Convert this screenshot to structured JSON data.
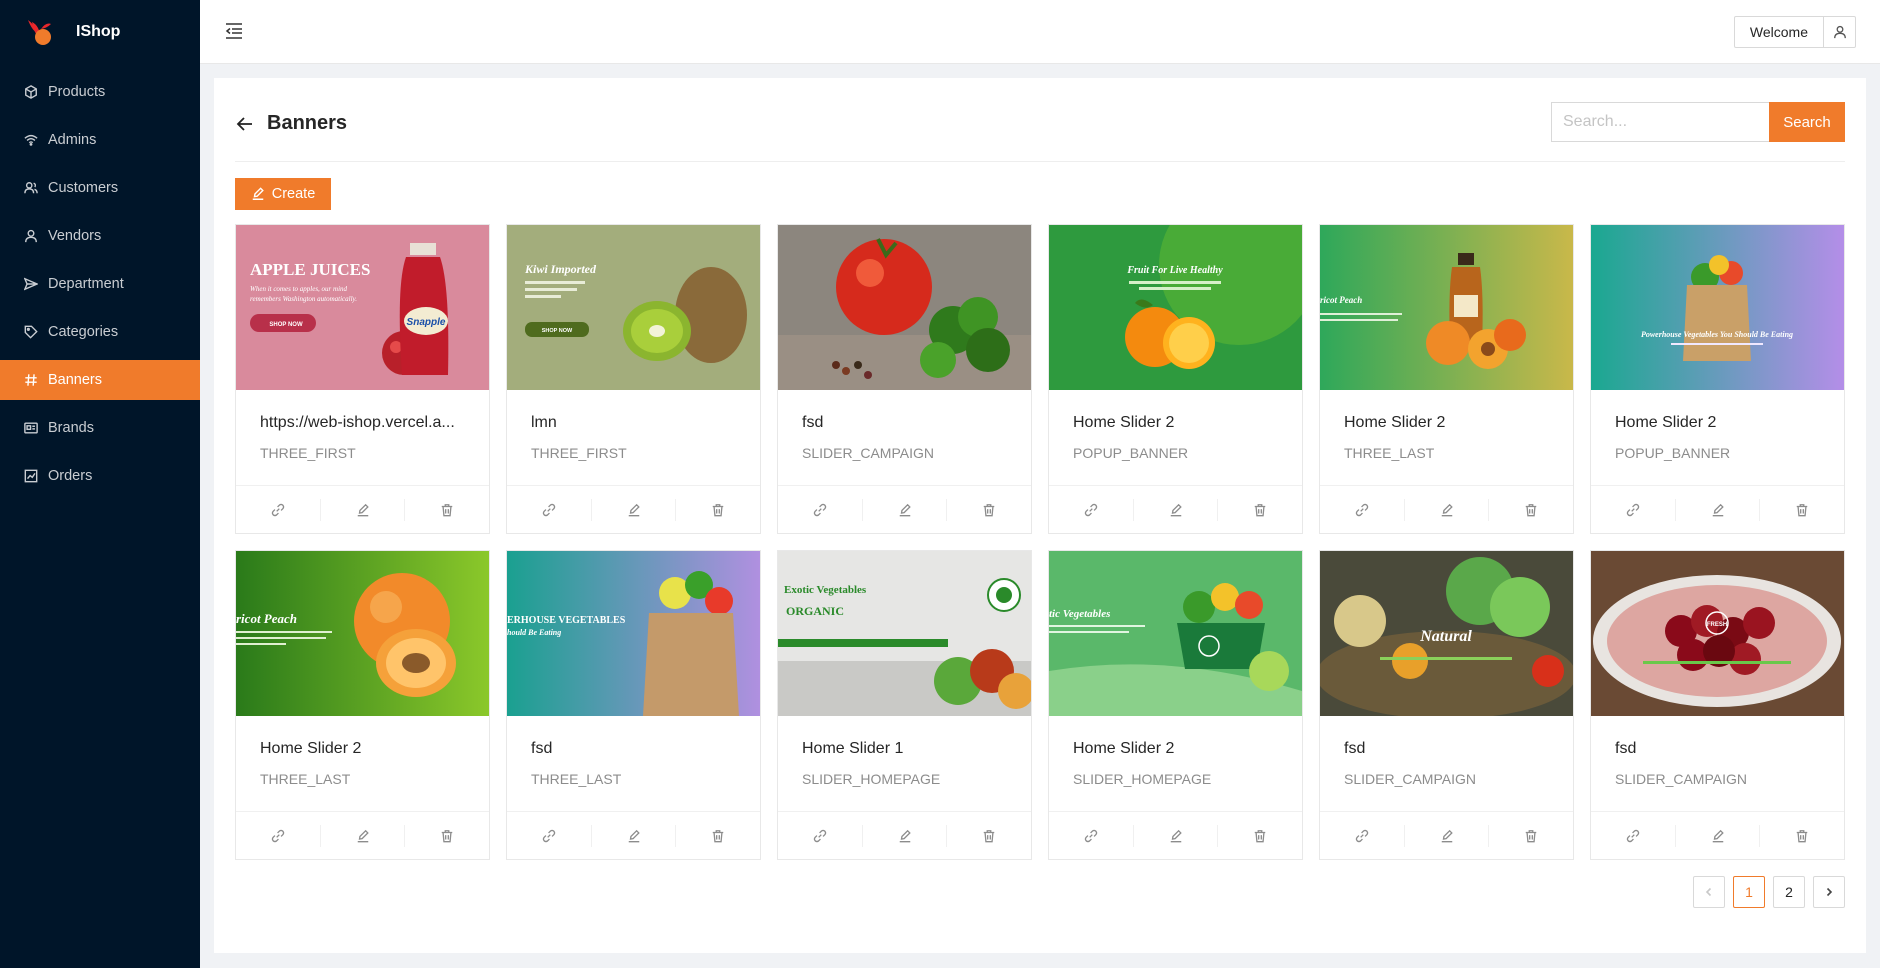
{
  "app": {
    "name": "IShop",
    "accent": "#f07b2b",
    "sidebar_bg": "#001529"
  },
  "sidebar": {
    "items": [
      {
        "label": "Products",
        "icon": "cube-icon",
        "active": false
      },
      {
        "label": "Admins",
        "icon": "wifi-icon",
        "active": false
      },
      {
        "label": "Customers",
        "icon": "users-icon",
        "active": false
      },
      {
        "label": "Vendors",
        "icon": "user-icon",
        "active": false
      },
      {
        "label": "Department",
        "icon": "send-icon",
        "active": false
      },
      {
        "label": "Categories",
        "icon": "tag-icon",
        "active": false
      },
      {
        "label": "Banners",
        "icon": "hash-icon",
        "active": true
      },
      {
        "label": "Brands",
        "icon": "id-card-icon",
        "active": false
      },
      {
        "label": "Orders",
        "icon": "chart-icon",
        "active": false
      }
    ]
  },
  "header": {
    "welcome_label": "Welcome"
  },
  "page": {
    "title": "Banners",
    "search_placeholder": "Search...",
    "search_label": "Search",
    "create_label": "Create"
  },
  "banners": [
    {
      "title": "https://web-ishop.vercel.a...",
      "type": "THREE_FIRST",
      "image": "apple-juice"
    },
    {
      "title": "lmn",
      "type": "THREE_FIRST",
      "image": "kiwi"
    },
    {
      "title": "fsd",
      "type": "SLIDER_CAMPAIGN",
      "image": "tomato"
    },
    {
      "title": "Home Slider 2",
      "type": "POPUP_BANNER",
      "image": "orange"
    },
    {
      "title": "Home Slider 2",
      "type": "THREE_LAST",
      "image": "apricot-juice"
    },
    {
      "title": "Home Slider 2",
      "type": "POPUP_BANNER",
      "image": "grocery-bag"
    },
    {
      "title": "Home Slider 2",
      "type": "THREE_LAST",
      "image": "apricot"
    },
    {
      "title": "fsd",
      "type": "THREE_LAST",
      "image": "vegetable-bag"
    },
    {
      "title": "Home Slider 1",
      "type": "SLIDER_HOMEPAGE",
      "image": "exotic-vegetables"
    },
    {
      "title": "Home Slider 2",
      "type": "SLIDER_HOMEPAGE",
      "image": "vegetable-box"
    },
    {
      "title": "fsd",
      "type": "SLIDER_CAMPAIGN",
      "image": "natural-basket"
    },
    {
      "title": "fsd",
      "type": "SLIDER_CAMPAIGN",
      "image": "cherries"
    }
  ],
  "banner_texts": {
    "apple_title": "APPLE JUICES",
    "apple_sub1": "When it comes to apples, our mind",
    "apple_sub2": "remembers Washington automatically.",
    "shop_now": "SHOP NOW",
    "snapple": "Snapple",
    "kiwi_title": "Kiwi Imported",
    "orange_title": "Fruit For Live Healthy",
    "apricot_title": "ricot Peach",
    "bag_title": "Powerhouse Vegetables You Should Be Eating",
    "bag2_title": "ERHOUSE VEGETABLES",
    "bag2_sub": "hould Be Eating",
    "exotic_title": "Exotic Vegetables",
    "organic": "ORGANIC",
    "box_title": "tic Vegetables",
    "natural": "Natural",
    "fresh": "FRESH"
  },
  "pagination": {
    "pages": [
      "1",
      "2"
    ],
    "current": "1"
  }
}
